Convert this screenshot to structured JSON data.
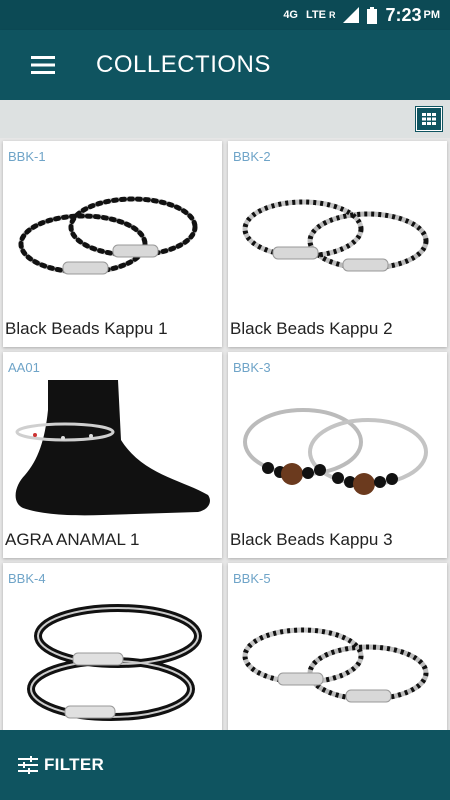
{
  "status_bar": {
    "net_top": "4G",
    "net_lte": "LTE",
    "roaming": "R",
    "time": "7:23",
    "ampm": "PM"
  },
  "app_bar": {
    "title": "COLLECTIONS"
  },
  "products": [
    {
      "code": "BBK-1",
      "title": "Black Beads Kappu 1"
    },
    {
      "code": "BBK-2",
      "title": "Black Beads Kappu 2"
    },
    {
      "code": "AA01",
      "title": "AGRA ANAMAL 1"
    },
    {
      "code": "BBK-3",
      "title": "Black Beads Kappu 3"
    },
    {
      "code": "BBK-4",
      "title": ""
    },
    {
      "code": "BBK-5",
      "title": ""
    }
  ],
  "bottom_bar": {
    "filter_label": "FILTER"
  },
  "colors": {
    "primary": "#0f5460",
    "status": "#0c4a55",
    "code_text": "#6fa4c8",
    "background": "#e6e6e6"
  },
  "icons": {
    "menu": "hamburger-icon",
    "grid": "grid-view-icon",
    "filter": "sliders-icon"
  }
}
